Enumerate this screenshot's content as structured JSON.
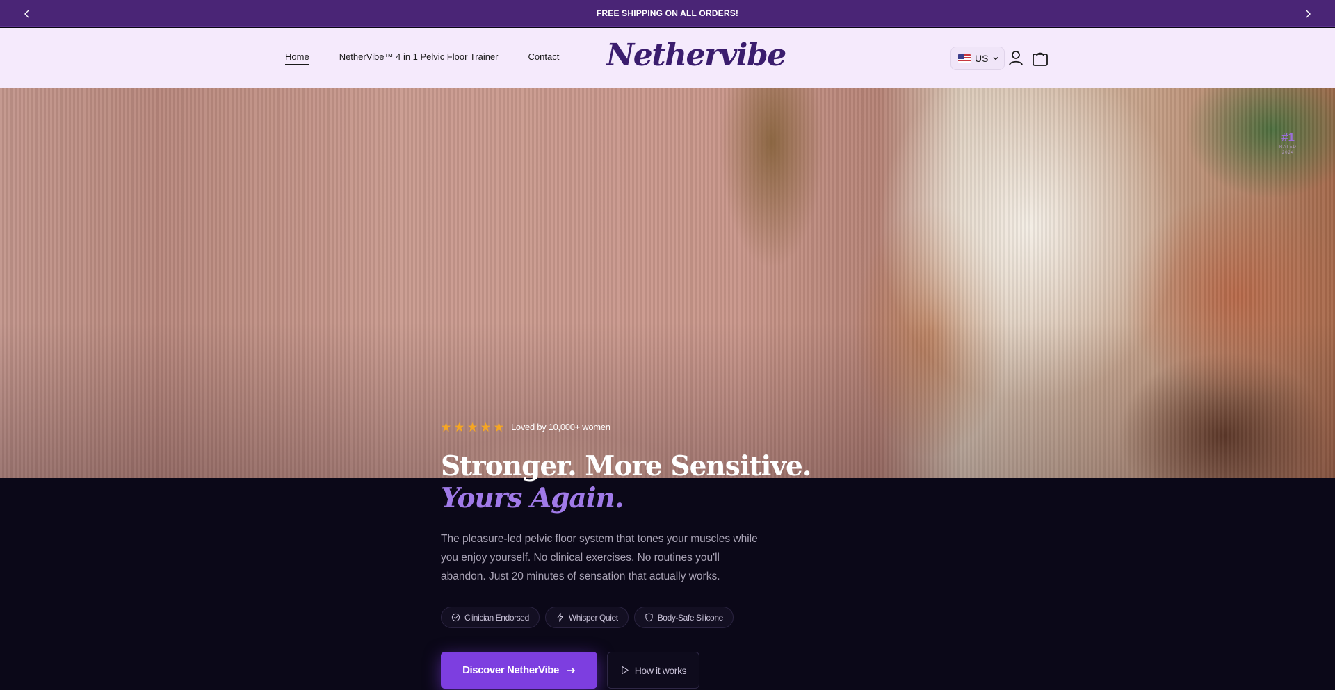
{
  "announcement": {
    "text": "FREE SHIPPING ON ALL ORDERS!",
    "prev_icon": "chevron-left-icon",
    "next_icon": "chevron-right-icon"
  },
  "header": {
    "nav": [
      {
        "label": "Home",
        "active": true
      },
      {
        "label": "NetherVibe™ 4 in 1 Pelvic Floor Trainer",
        "active": false
      },
      {
        "label": "Contact",
        "active": false
      }
    ],
    "logo_text": "Nethervibe",
    "locale": {
      "flag_icon": "us-flag-icon",
      "label": "US"
    },
    "account_icon": "user-icon",
    "cart_icon": "shopping-bag-icon"
  },
  "hero": {
    "badge": {
      "number": "#1",
      "line1": "RATED",
      "line2": "2024"
    },
    "rating": {
      "stars": 5,
      "text": "Loved by 10,000+ women"
    },
    "headline": "Stronger. More Sensitive.",
    "headline_accent": "Yours Again.",
    "description": "The pleasure-led pelvic floor system that tones your muscles while you enjoy yourself. No clinical exercises. No routines you'll abandon. Just 20 minutes of sensation that actually works.",
    "features": [
      {
        "icon": "check-circle-icon",
        "label": "Clinician Endorsed"
      },
      {
        "icon": "lightning-icon",
        "label": "Whisper Quiet"
      },
      {
        "icon": "shield-icon",
        "label": "Body-Safe Silicone"
      }
    ],
    "cta_primary": {
      "label": "Discover NetherVibe",
      "icon": "arrow-right-icon"
    },
    "cta_secondary": {
      "label": "How it works",
      "icon": "play-icon"
    }
  },
  "colors": {
    "announcement_bg": "#4a2576",
    "header_bg": "#f5eafc",
    "logo": "#3b1d6e",
    "accent": "#a07ae8",
    "cta": "#7d3ee0",
    "star": "#f5a623",
    "dark_bg": "#0b0818"
  }
}
